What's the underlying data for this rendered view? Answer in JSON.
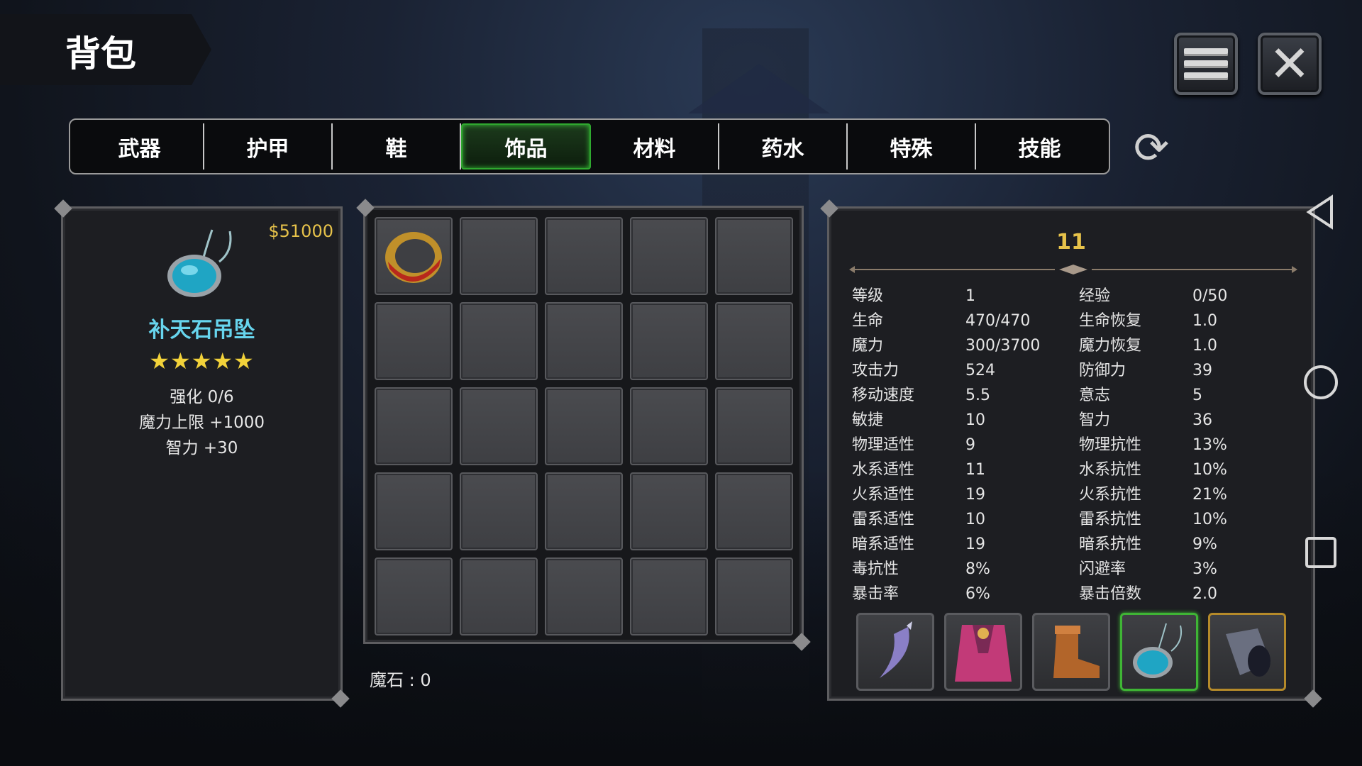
{
  "header": {
    "title": "背包"
  },
  "icons": {
    "menu": "menu-icon",
    "close": "close-icon",
    "refresh": "refresh-icon"
  },
  "tabs": [
    {
      "label": "武器",
      "active": false
    },
    {
      "label": "护甲",
      "active": false
    },
    {
      "label": "鞋",
      "active": false
    },
    {
      "label": "饰品",
      "active": true
    },
    {
      "label": "材料",
      "active": false
    },
    {
      "label": "药水",
      "active": false
    },
    {
      "label": "特殊",
      "active": false
    },
    {
      "label": "技能",
      "active": false
    }
  ],
  "selected_item": {
    "price": "$51000",
    "icon": "pendant-icon",
    "name": "补天石吊坠",
    "stars": "★★★★★",
    "enhance": "强化 0/6",
    "bonus_1": "魔力上限  +1000",
    "bonus_2": "智力  +30"
  },
  "inventory": {
    "slots": [
      "ring-icon",
      "",
      "",
      "",
      "",
      "",
      "",
      "",
      "",
      "",
      "",
      "",
      "",
      "",
      "",
      "",
      "",
      "",
      "",
      "",
      "",
      "",
      "",
      "",
      ""
    ],
    "magic_stone": "魔石 : 0"
  },
  "character": {
    "level": "11",
    "stats": [
      [
        "等级",
        "1",
        "经验",
        "0/50"
      ],
      [
        "生命",
        "470/470",
        "生命恢复",
        "1.0"
      ],
      [
        "魔力",
        "300/3700",
        "魔力恢复",
        "1.0"
      ],
      [
        "攻击力",
        "524",
        "防御力",
        "39"
      ],
      [
        "移动速度",
        "5.5",
        "意志",
        "5"
      ],
      [
        "敏捷",
        "10",
        "智力",
        "36"
      ],
      [
        "物理适性",
        "9",
        "物理抗性",
        "13%"
      ],
      [
        "水系适性",
        "11",
        "水系抗性",
        "10%"
      ],
      [
        "火系适性",
        "19",
        "火系抗性",
        "21%"
      ],
      [
        "雷系适性",
        "10",
        "雷系抗性",
        "10%"
      ],
      [
        "暗系适性",
        "19",
        "暗系抗性",
        "9%"
      ],
      [
        "毒抗性",
        "8%",
        "闪避率",
        "3%"
      ],
      [
        "暴击率",
        "6%",
        "暴击倍数",
        "2.0"
      ]
    ],
    "equipment": [
      "blade-icon",
      "armor-icon",
      "boot-icon",
      "pendant-icon",
      "bracer-icon"
    ]
  },
  "colors": {
    "accent_gold": "#e6c24a",
    "item_name": "#67d5ee",
    "active_tab": "#2fa82f"
  }
}
